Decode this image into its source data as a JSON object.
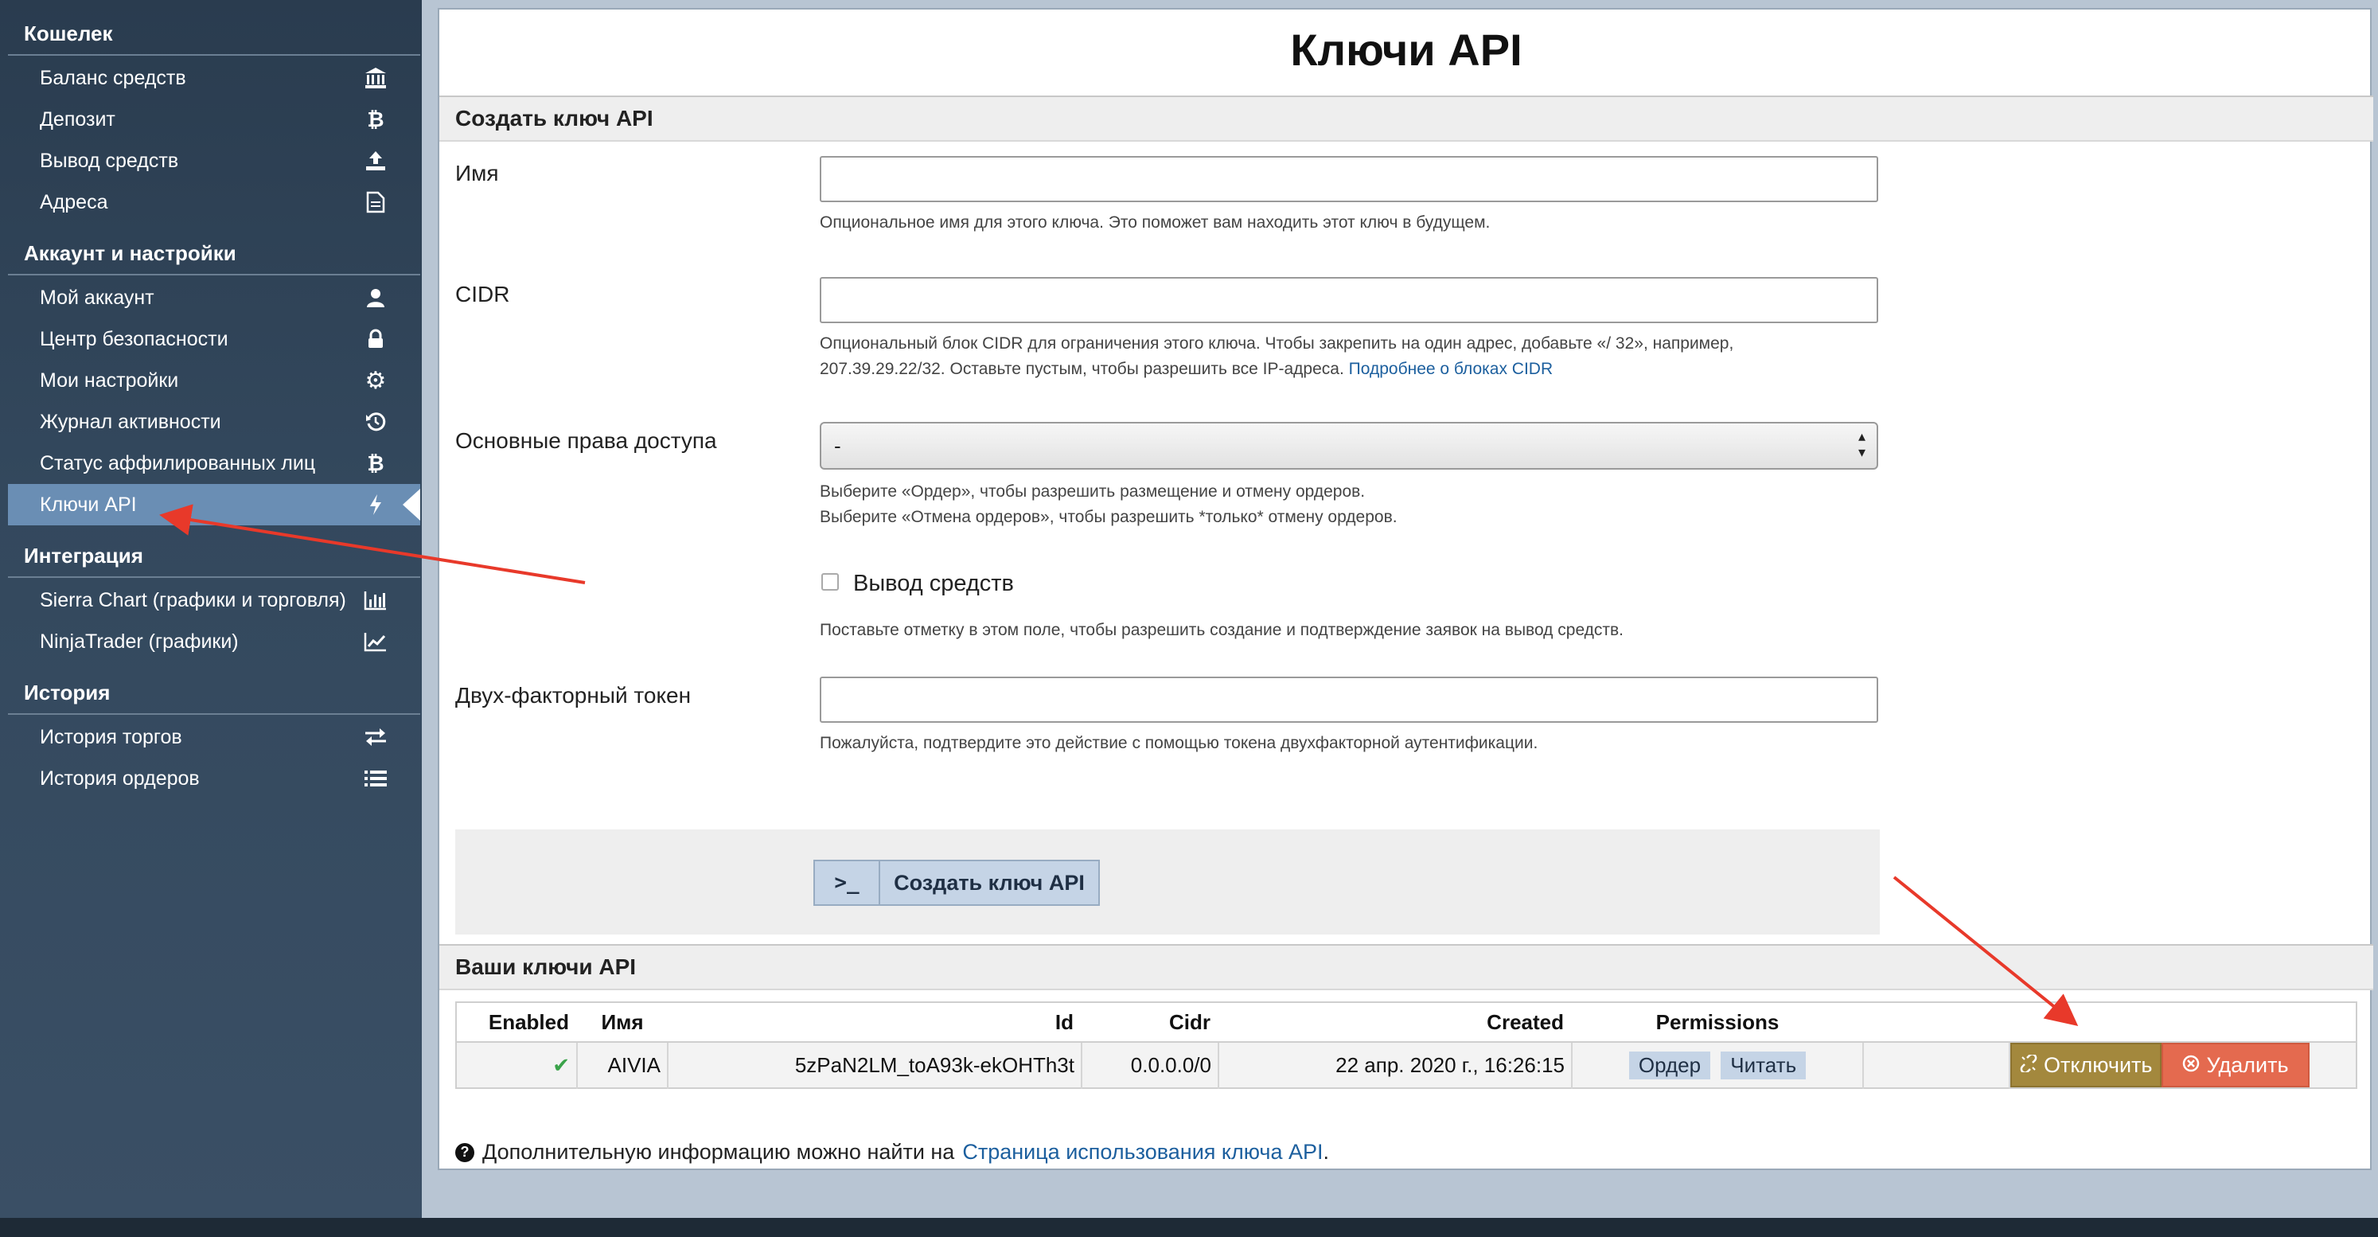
{
  "sidebar": {
    "sections": [
      {
        "title": "Кошелек",
        "items": [
          {
            "label": "Баланс средств",
            "icon": "bank-icon"
          },
          {
            "label": "Депозит",
            "icon": "bitcoin-icon"
          },
          {
            "label": "Вывод средств",
            "icon": "upload-icon"
          },
          {
            "label": "Адреса",
            "icon": "document-icon"
          }
        ]
      },
      {
        "title": "Аккаунт и настройки",
        "items": [
          {
            "label": "Мой аккаунт",
            "icon": "user-icon"
          },
          {
            "label": "Центр безопасности",
            "icon": "lock-icon"
          },
          {
            "label": "Мои настройки",
            "icon": "gear-icon"
          },
          {
            "label": "Журнал активности",
            "icon": "history-icon"
          },
          {
            "label": "Статус аффилированных лиц",
            "icon": "bitcoin-icon"
          },
          {
            "label": "Ключи API",
            "icon": "bolt-icon",
            "active": true
          }
        ]
      },
      {
        "title": "Интеграция",
        "items": [
          {
            "label": "Sierra Chart (графики и торговля)",
            "icon": "bar-chart-icon"
          },
          {
            "label": "NinjaTrader (графики)",
            "icon": "line-chart-icon"
          }
        ]
      },
      {
        "title": "История",
        "items": [
          {
            "label": "История торгов",
            "icon": "exchange-icon"
          },
          {
            "label": "История ордеров",
            "icon": "list-icon"
          }
        ]
      }
    ]
  },
  "main": {
    "title": "Ключи API",
    "create_section_title": "Создать ключ API",
    "form": {
      "name_label": "Имя",
      "name_value": "",
      "name_help": "Опциональное имя для этого ключа. Это поможет вам находить этот ключ в будущем.",
      "cidr_label": "CIDR",
      "cidr_value": "",
      "cidr_help_line1": "Опциональный блок CIDR для ограничения этого ключа. Чтобы закрепить на один адрес, добавьте «/ 32», например,",
      "cidr_help_line2": "207.39.29.22/32. Оставьте пустым, чтобы разрешить все IP-адреса.",
      "cidr_help_link": "Подробнее о блоках CIDR",
      "perm_label": "Основные права доступа",
      "perm_value": "-",
      "perm_help_line1": "Выберите «Ордер», чтобы разрешить размещение и отмену ордеров.",
      "perm_help_line2": "Выберите «Отмена ордеров», чтобы разрешить *только* отмену ордеров.",
      "withdraw_label": "Вывод средств",
      "withdraw_checked": false,
      "withdraw_help": "Поставьте отметку в этом поле, чтобы разрешить создание и подтверждение заявок на вывод средств.",
      "token_label": "Двух-факторный токен",
      "token_value": "",
      "token_help": "Пожалуйста, подтвердите это действие с помощью токена двухфакторной аутентификации.",
      "create_prompt": ">_",
      "create_button": "Создать ключ API"
    },
    "keys_section_title": "Ваши ключи API",
    "table": {
      "headers": {
        "enabled": "Enabled",
        "name": "Имя",
        "id": "Id",
        "cidr": "Cidr",
        "created": "Created",
        "permissions": "Permissions"
      },
      "rows": [
        {
          "enabled": "✔",
          "name": "AIVIA",
          "id": "5zPaN2LM_toA93k-ekOHTh3t",
          "cidr": "0.0.0.0/0",
          "created": "22 апр. 2020 г., 16:26:15",
          "perm1": "Ордер",
          "perm2": "Читать",
          "disable": "Отключить",
          "delete": "Удалить"
        }
      ]
    },
    "footer_text": "Дополнительную информацию можно найти на",
    "footer_link": "Страница использования ключа API",
    "footer_end": "."
  },
  "colors": {
    "sidebar_bg": "#2c3e50",
    "active_item": "#6a8eb4",
    "disable_button": "#a3883d",
    "delete_button": "#e46a4f",
    "annotation_arrow": "#e8392a",
    "link": "#1c5f9e"
  }
}
